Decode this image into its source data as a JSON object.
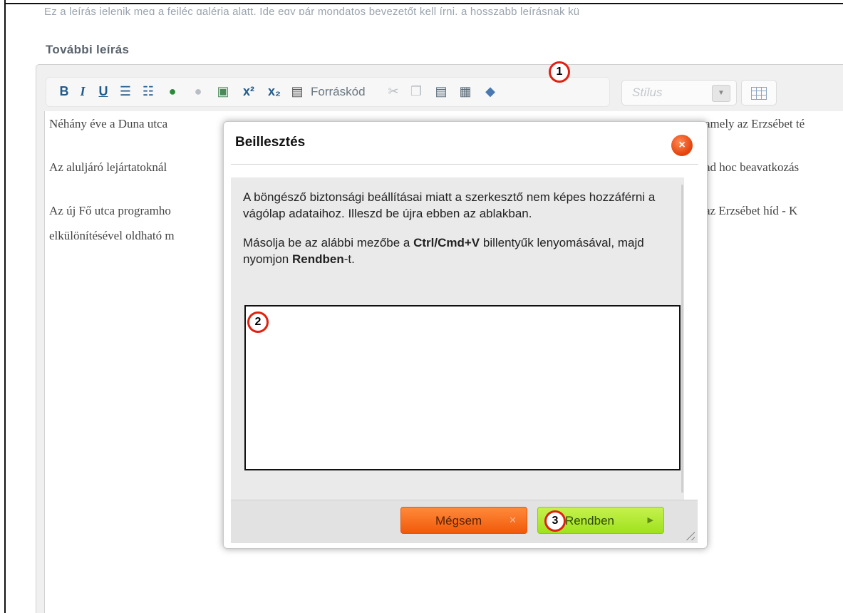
{
  "intro_text": "Ez a leírás jelenik meg a fejléc galéria alatt. Ide egy pár mondatos bevezetőt kell írni, a hosszabb leírásnak kü",
  "section_label": "További leírás",
  "toolbar": {
    "bold_label": "B",
    "italic_label": "I",
    "underline_label": "U",
    "superscript_label": "x²",
    "subscript_label": "x₂",
    "source_label": "Forráskód",
    "style_placeholder": "Stílus"
  },
  "content": {
    "line1_left": "Néhány éve a Duna utca",
    "line1_right": "amely az Erzsébet té",
    "line2_left": "Az aluljáró lejártatoknál",
    "line2_right": "ad hoc beavatkozás",
    "line3_left": "Az új Fő utca programho",
    "line3_right": "az Erzsébet híd - K",
    "line4_left": "elkülönítésével oldható m"
  },
  "dialog": {
    "title": "Beillesztés",
    "close_icon": "×",
    "para1": "A böngésző biztonsági beállításai miatt a szerkesztő nem képes hozzáférni a vágólap adataihoz. Illeszd be újra ebben az ablakban.",
    "para2_start": "Másolja be az alábbi mezőbe a ",
    "para2_keys": "Ctrl/Cmd+V",
    "para2_mid": " billentyűk lenyomásával, majd nyomjon ",
    "para2_ok": "Rendben",
    "para2_end": "-t.",
    "paste_value": "",
    "cancel_label": "Mégsem",
    "ok_label": "Rendben"
  },
  "badges": [
    "1",
    "2",
    "3"
  ],
  "colors": {
    "badge_ring": "#e02010",
    "cancel_bg": "#f05a0a",
    "ok_bg": "#9fe21e",
    "toolbar_icon": "#1e5a8c"
  }
}
